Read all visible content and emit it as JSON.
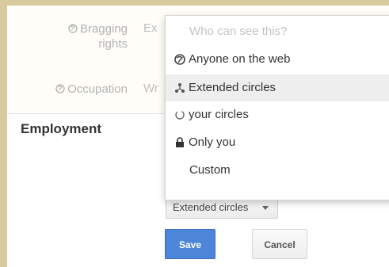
{
  "fields": {
    "bragging_rights": {
      "label_line1": "Bragging",
      "label_line2": "rights",
      "value_fragment": "Ex"
    },
    "occupation": {
      "label": "Occupation",
      "value_fragment": "Wr"
    }
  },
  "employment": {
    "title": "Employment"
  },
  "visibility_menu": {
    "header": "Who can see this?",
    "items": [
      {
        "label": "Anyone on the web",
        "icon": "globe-icon"
      },
      {
        "label": "Extended circles",
        "icon": "extended-circles-icon",
        "selected": true
      },
      {
        "label": "your circles",
        "icon": "circles-icon"
      },
      {
        "label": "Only you",
        "icon": "lock-icon"
      },
      {
        "label": "Custom",
        "icon": ""
      }
    ]
  },
  "visibility_select": {
    "value": "Extended circles"
  },
  "actions": {
    "save_label": "Save",
    "cancel_label": "Cancel"
  },
  "colors": {
    "save_blue": "#4d86d9",
    "frame": "#d8cba0",
    "muted_text": "#b3b3b3"
  }
}
